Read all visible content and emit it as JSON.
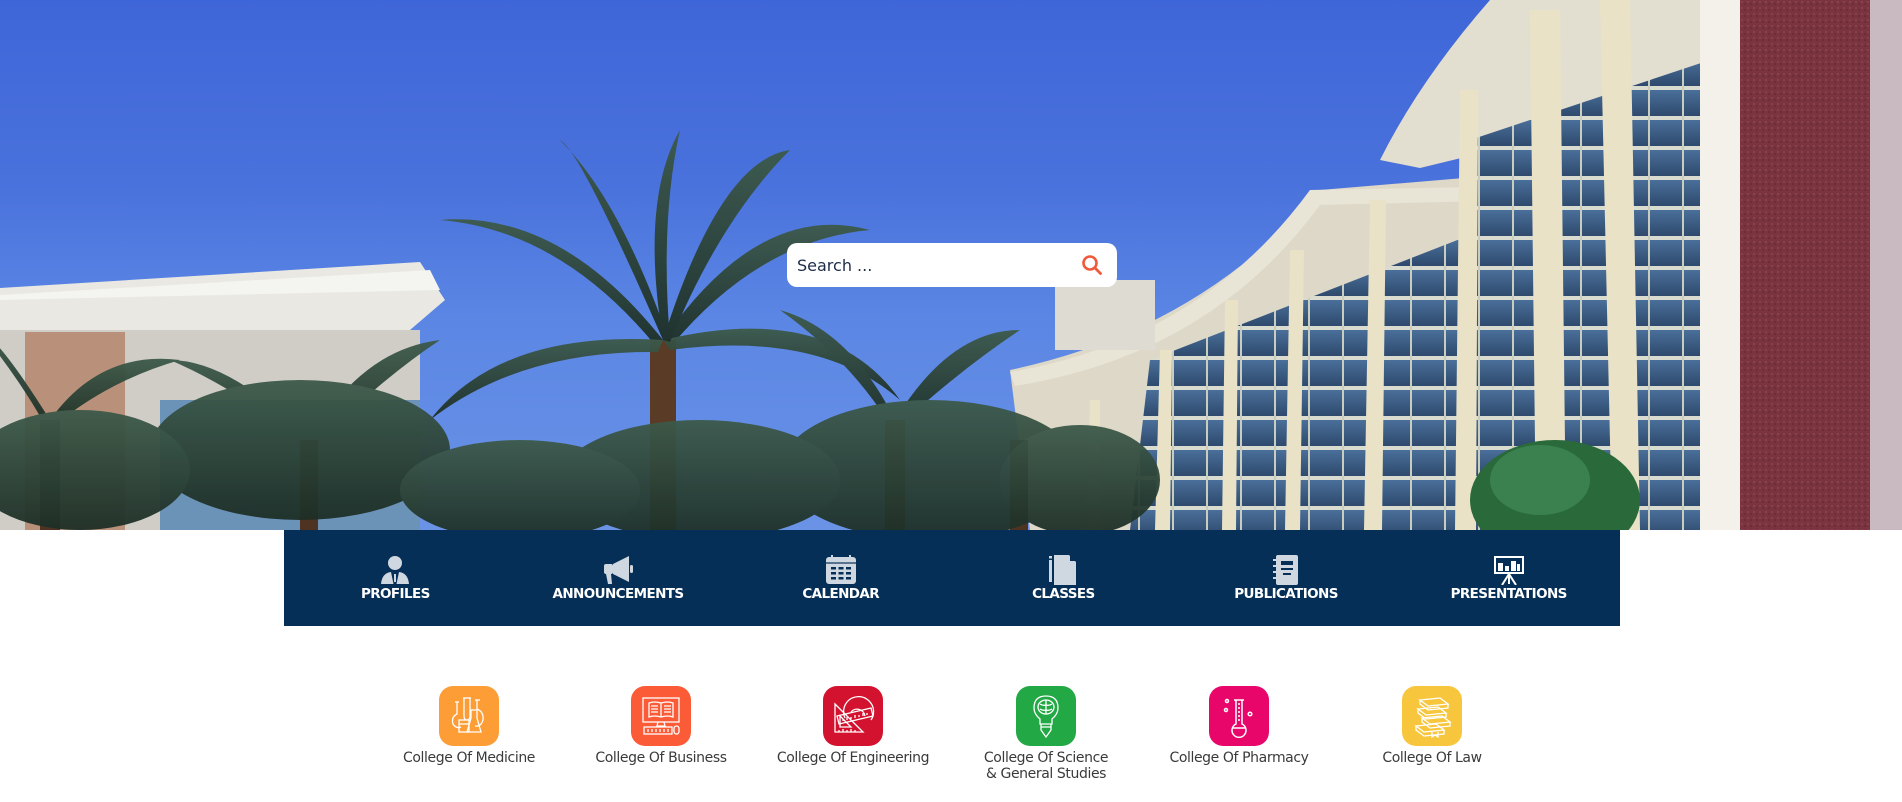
{
  "hero": {
    "image_alt": "Campus buildings with palm trees under a blue sky"
  },
  "search": {
    "placeholder": "Search ...",
    "value": "",
    "icon": "search-icon",
    "icon_color": "#f05a3c"
  },
  "quicknav": {
    "background": "#062f57",
    "items": [
      {
        "label": "PROFILES",
        "icon": "profile-icon"
      },
      {
        "label": "ANNOUNCEMENTS",
        "icon": "megaphone-icon"
      },
      {
        "label": "CALENDAR",
        "icon": "calendar-icon"
      },
      {
        "label": "CLASSES",
        "icon": "document-icon"
      },
      {
        "label": "PUBLICATIONS",
        "icon": "notebook-icon"
      },
      {
        "label": "PRESENTATIONS",
        "icon": "presentation-board-icon"
      }
    ]
  },
  "colleges": [
    {
      "name": "College Of Medicine",
      "icon": "lab-flasks-icon",
      "color": "#fd9d36"
    },
    {
      "name": "College Of Business",
      "icon": "computer-book-icon",
      "color": "#fc5b37"
    },
    {
      "name": "College Of Engineering",
      "icon": "protractor-ruler-icon",
      "color": "#d3122f"
    },
    {
      "name": "College Of Science & General Studies",
      "icon": "bulb-brain-icon",
      "color": "#22a844"
    },
    {
      "name": "College Of Pharmacy",
      "icon": "test-tube-icon",
      "color": "#e8066a"
    },
    {
      "name": "College Of Law",
      "icon": "books-stack-icon",
      "color": "#f7c63c"
    }
  ]
}
